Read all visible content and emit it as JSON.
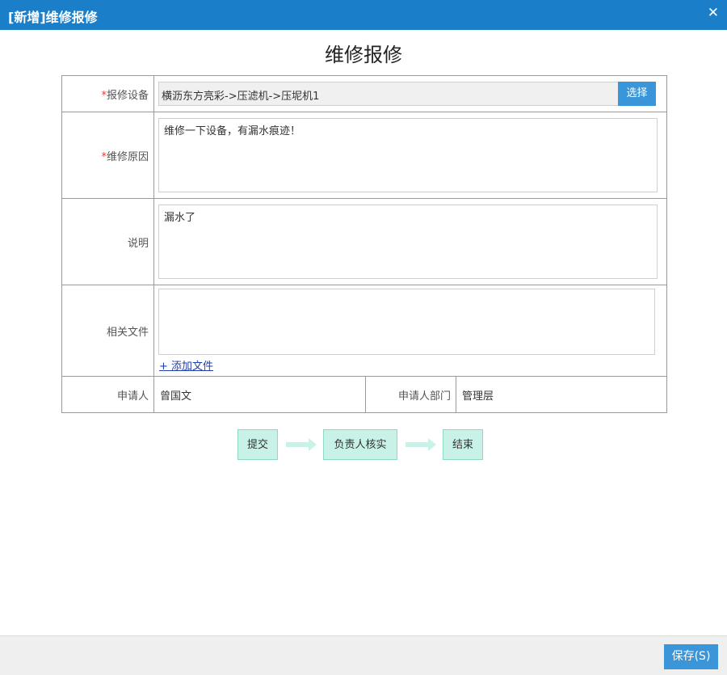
{
  "window": {
    "title": "[新增]维修报修",
    "close_icon": "close-icon"
  },
  "form_title": "维修报修",
  "fields": {
    "device": {
      "required_mark": "*",
      "label": "报修设备",
      "value": "横沥东方亮彩->压滤机->压坭机1",
      "select_label": "选择"
    },
    "reason": {
      "required_mark": "*",
      "label": "维修原因",
      "value": "维修一下设备，有漏水痕迹！"
    },
    "description": {
      "label": "说明",
      "value": "漏水了"
    },
    "files": {
      "label": "相关文件",
      "add_label": "+ 添加文件"
    },
    "applicant": {
      "label": "申请人",
      "value": "曾国文"
    },
    "department": {
      "label": "申请人部门",
      "value": "管理层"
    }
  },
  "workflow": {
    "steps": [
      "提交",
      "负责人核实",
      "结束"
    ],
    "colors": {
      "step_fill": "#c8f2e8",
      "step_border": "#8fd8c4"
    }
  },
  "footer": {
    "save_label": "保存(S)"
  },
  "colors": {
    "titlebar": "#1a7ec9",
    "button": "#3a96d8",
    "required": "#e53935"
  }
}
